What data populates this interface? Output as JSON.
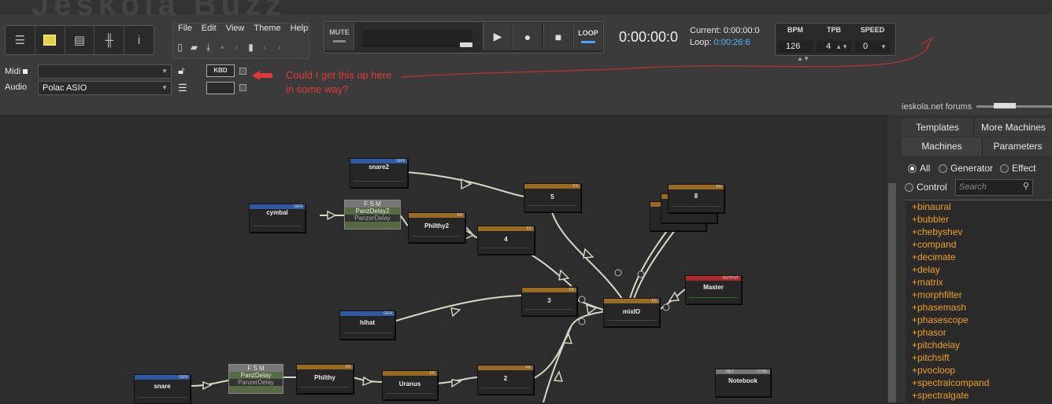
{
  "app": {
    "watermark": "Jeskola Buzz"
  },
  "menu": {
    "items": [
      "File",
      "Edit",
      "View",
      "Theme",
      "Help"
    ]
  },
  "transport": {
    "mute_label": "MUTE",
    "loop_label": "LOOP",
    "time": "0:00:00:0",
    "current": "Current: 0:00:00:0",
    "loop_prefix": "Loop:",
    "loop_value": "0:00:26:6"
  },
  "tempo": {
    "bpm_label": "BPM",
    "tpb_label": "TPB",
    "speed_label": "SPEED",
    "bpm": "126",
    "tpb": "4",
    "speed": "0"
  },
  "io": {
    "midi_label": "Midi",
    "midi_value": "",
    "audio_label": "Audio",
    "audio_value": "Polac ASIO",
    "kbd_label": "KBD"
  },
  "annotation": {
    "line1": "Could I get this up here",
    "line2": "in some way?",
    "color": "#e03838"
  },
  "forums_link": "ieskola.net forums",
  "right_panel": {
    "tabs_top": [
      "Templates",
      "More Machines"
    ],
    "tabs_bottom": [
      "Machines",
      "Parameters"
    ],
    "filters": [
      "All",
      "Generator",
      "Effect",
      "Control"
    ],
    "search_placeholder": "Search",
    "machines": [
      "+binaural",
      "+bubbler",
      "+chebyshev",
      "+compand",
      "+decimate",
      "+delay",
      "+matrix",
      "+morphfilter",
      "+phasemash",
      "+phasescope",
      "+phasor",
      "+pitchdelay",
      "+pitchsift",
      "+pvocloop",
      "+spectralcompand",
      "+spectralgate"
    ]
  },
  "machines": {
    "snare2": "snare2",
    "cymbal": "cymbal",
    "panzdelay2": "PanzDelay2",
    "panzdelay2_sub": "PanzerDelay",
    "philthy2": "Philthy2",
    "m5": "5",
    "m4": "4",
    "m8": "8",
    "m3": "3",
    "mixio": "mixIO",
    "master": "Master",
    "hihat": "hihat",
    "snare": "snare",
    "panzdelay": "PanzDelay",
    "panzdelay_sub": "PanzerDelay",
    "philthy": "Philthy",
    "uranus": "Uranus",
    "m2": "2",
    "notebook": "Notebook",
    "gen_tag": "GEN",
    "fx_tag": "FX",
    "out_tag": "OUTPUT",
    "net_tag": ".NET",
    "ctrl_tag": "CTRL",
    "fsm": "F S M"
  },
  "wire_badges": [
    "4",
    "5",
    "6",
    "2",
    "3"
  ]
}
